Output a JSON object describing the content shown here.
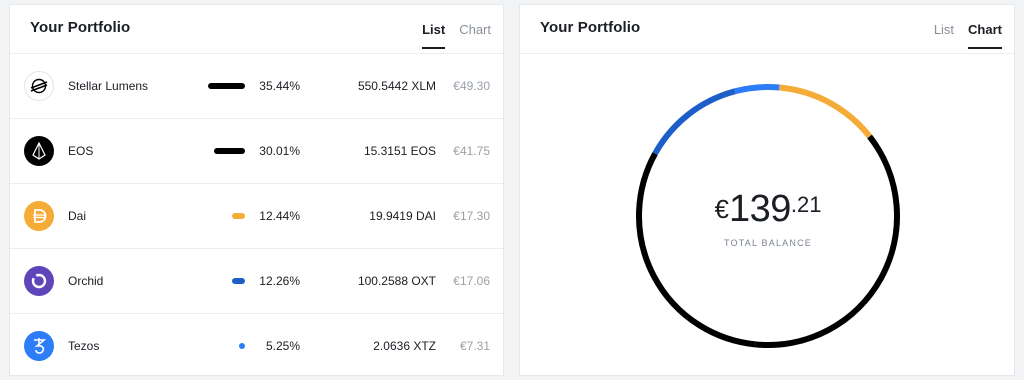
{
  "list_card": {
    "title": "Your Portfolio",
    "tabs": [
      {
        "label": "List",
        "active": true
      },
      {
        "label": "Chart",
        "active": false
      }
    ],
    "rows": [
      {
        "name": "Stellar Lumens",
        "icon": "stellar-icon",
        "percent": "35.44%",
        "share": 35.44,
        "amount": "550.5442 XLM",
        "fiat": "€49.30",
        "bar_color": "#000000"
      },
      {
        "name": "EOS",
        "icon": "eos-icon",
        "percent": "30.01%",
        "share": 30.01,
        "amount": "15.3151 EOS",
        "fiat": "€41.75",
        "bar_color": "#000000"
      },
      {
        "name": "Dai",
        "icon": "dai-icon",
        "percent": "12.44%",
        "share": 12.44,
        "amount": "19.9419 DAI",
        "fiat": "€17.30",
        "bar_color": "#f5ac37"
      },
      {
        "name": "Orchid",
        "icon": "orchid-icon",
        "percent": "12.26%",
        "share": 12.26,
        "amount": "100.2588 OXT",
        "fiat": "€17.06",
        "bar_color": "#1c5fc9"
      },
      {
        "name": "Tezos",
        "icon": "tezos-icon",
        "percent": "5.25%",
        "share": 5.25,
        "amount": "2.0636 XTZ",
        "fiat": "€7.31",
        "bar_color": "#2c7df7"
      }
    ]
  },
  "chart_card": {
    "title": "Your Portfolio",
    "tabs": [
      {
        "label": "List",
        "active": false
      },
      {
        "label": "Chart",
        "active": true
      }
    ],
    "balance": {
      "currency": "€",
      "integer": "139",
      "decimal": ".21",
      "label": "TOTAL BALANCE"
    }
  },
  "chart_data": {
    "type": "pie",
    "style": "donut",
    "categories": [
      "Stellar Lumens",
      "EOS",
      "Dai",
      "Orchid",
      "Tezos"
    ],
    "values": [
      35.44,
      30.01,
      12.44,
      12.26,
      5.25
    ],
    "colors": [
      "#000000",
      "#000000",
      "#f5ac37",
      "#1c5fc9",
      "#2c7df7"
    ],
    "center_text": "€139.21",
    "center_label": "TOTAL BALANCE"
  }
}
